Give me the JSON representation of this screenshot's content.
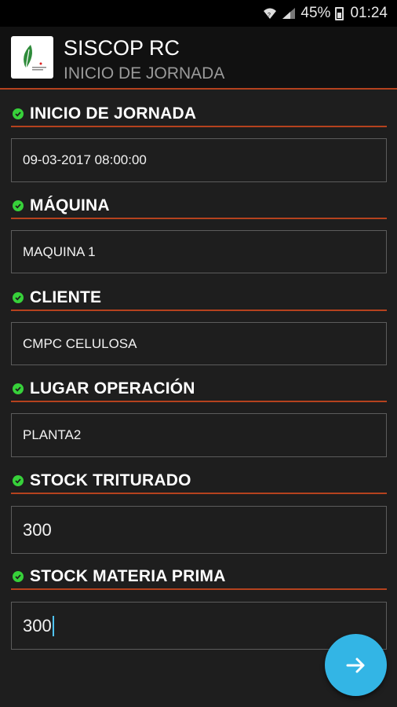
{
  "status_bar": {
    "battery": "45%",
    "time": "01:24"
  },
  "app_bar": {
    "title": "SISCOP RC",
    "subtitle": "INICIO DE JORNADA"
  },
  "form": {
    "fields": [
      {
        "label": "INICIO DE JORNADA",
        "value": "09-03-2017 08:00:00"
      },
      {
        "label": "MÁQUINA",
        "value": "MAQUINA 1"
      },
      {
        "label": "CLIENTE",
        "value": "CMPC CELULOSA"
      },
      {
        "label": "LUGAR OPERACIÓN",
        "value": "PLANTA2"
      },
      {
        "label": "STOCK TRITURADO",
        "value": "300"
      },
      {
        "label": "STOCK MATERIA PRIMA",
        "value": "300"
      }
    ]
  },
  "colors": {
    "accent": "#b5421e",
    "check": "#37d13a",
    "fab": "#33b5e5"
  },
  "icons": {
    "fab": "arrow-right-icon",
    "check": "check-circle-icon"
  }
}
